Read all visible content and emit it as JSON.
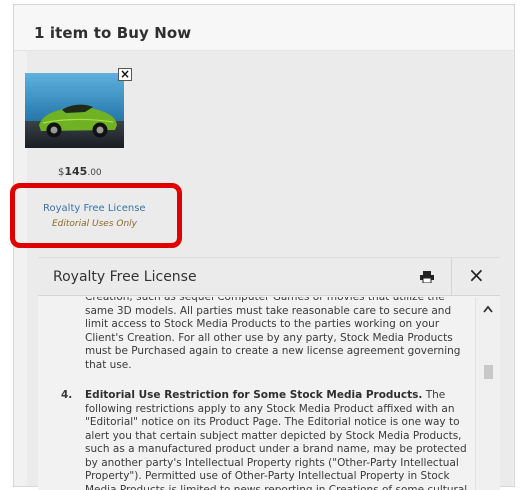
{
  "cart": {
    "title": "1 item to Buy Now",
    "item": {
      "price_dollar": "$",
      "price_amount": "145",
      "price_cents": ".00",
      "license_link": "Royalty Free License",
      "license_note": "Editorial Uses Only"
    },
    "remove_label": "×"
  },
  "panel": {
    "title": "Royalty Free License",
    "close_label": "×",
    "text_continuation": "Creation, such as sequel Computer Games or movies that utilize the same 3D models. All parties must take reasonable care to secure and limit access to Stock Media Products to the parties working on your Client's Creation. For all other use by any party, Stock Media Products must be Purchased again to create a new license agreement governing that use.",
    "item4_number": "4.",
    "item4_heading": "Editorial Use Restriction for Some Stock Media Products.",
    "item4_body": " The following restrictions apply to any Stock Media Product affixed with an \"Editorial\" notice on its Product Page. The Editorial notice is one way to alert you that certain subject matter depicted by Stock Media Products, such as a manufactured product under a brand name, may be protected by another party's Intellectual Property rights (\"Other-Party Intellectual Property\"). Permitted use of Other-Party Intellectual Property in Stock Media Products is limited to news reporting in Creations of some cultural, editorial"
  },
  "icons": {
    "print": "printer-icon",
    "close": "close-icon",
    "scroll_up": "chevron-up-icon",
    "remove": "close-icon"
  },
  "colors": {
    "highlight": "#e00000",
    "link": "#3a73a8",
    "editorial_note": "#8a6a2a"
  }
}
